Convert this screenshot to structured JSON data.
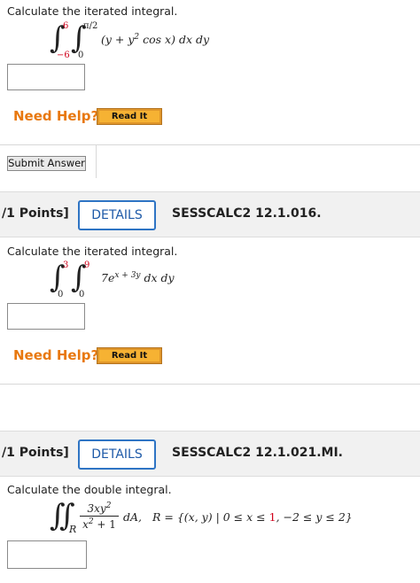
{
  "problem1": {
    "prompt": "Calculate the iterated integral.",
    "outer_upper": "6",
    "outer_lower": "−6",
    "inner_upper": "π/2",
    "inner_lower": "0",
    "integrand_a": "(y + y",
    "integrand_exp": "2",
    "integrand_b": " cos x) dx dy",
    "answer_value": ""
  },
  "help1": {
    "need_help": "Need Help?",
    "read_it": "Read It"
  },
  "submit": {
    "label": "Submit Answer"
  },
  "header2": {
    "points": "/1 Points]",
    "details": "DETAILS",
    "code": "SESSCALC2 12.1.016."
  },
  "problem2": {
    "prompt": "Calculate the iterated integral.",
    "outer_upper": "3",
    "outer_lower": "0",
    "inner_upper": "9",
    "inner_lower": "0",
    "integrand_coef": "7e",
    "integrand_exp": "x + 3y",
    "integrand_tail": " dx dy",
    "answer_value": ""
  },
  "help2": {
    "need_help": "Need Help?",
    "read_it": "Read It"
  },
  "header3": {
    "points": "/1 Points]",
    "details": "DETAILS",
    "code": "SESSCALC2 12.1.021.MI."
  },
  "problem3": {
    "prompt": "Calculate the double integral.",
    "region_sub": "R",
    "num_a": "3xy",
    "num_exp": "2",
    "den_a": "x",
    "den_exp": "2",
    "den_b": " + 1",
    "da": "dA,",
    "region_def_a": "R = {(x, y) | 0 ≤ x ≤ ",
    "region_def_red": "1",
    "region_def_b": ", −2 ≤ y ≤ 2}",
    "answer_value": ""
  }
}
